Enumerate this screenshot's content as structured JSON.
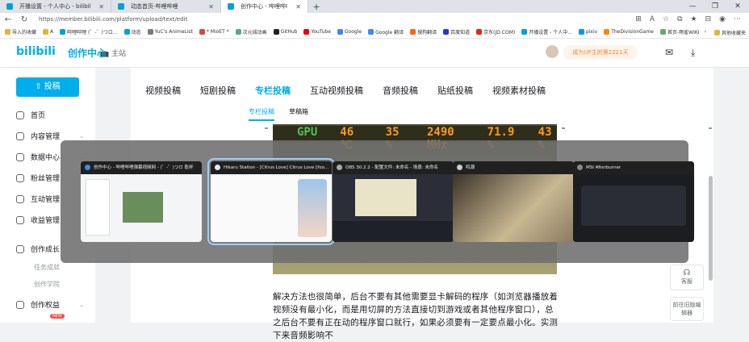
{
  "browser": {
    "tabs": [
      {
        "label": "开播设置 - 个人中心 - bilibili link",
        "active": false
      },
      {
        "label": "动态首页-哔哩哔哩",
        "active": false
      },
      {
        "label": "创作中心 - 哔哩哔哩弹幕视频网",
        "active": true
      }
    ],
    "new_tab": "+",
    "url": "https://member.bilibili.com/platform/upload/text/edit",
    "bookmarks": [
      "导入的收藏",
      "A",
      "哔哩哔哩 (゜-゜)つロ...",
      "动态",
      "YuC's AnimeList",
      "* MioET *",
      "次元城动画",
      "GitHub",
      "YouTube",
      "Google",
      "Google 翻译",
      "搜狗翻译",
      "百度知道",
      "京东(JD.COM)",
      "开播设置 - 个人中...",
      "pixiv",
      "TheDivisionGame",
      "首页-雨雀WIKI攻略..."
    ],
    "bookmarks_right": "其他收藏夹"
  },
  "site": {
    "logo": "bilibili",
    "logo_text": "创作中心",
    "home": "主站",
    "up_button": "成为UP主的第2221天"
  },
  "sidebar": {
    "post_button": "投稿",
    "items": [
      "首页",
      "内容管理",
      "数据中心",
      "粉丝管理",
      "互动管理",
      "收益管理",
      "创作成长",
      "创作权益"
    ],
    "sub_items": [
      "任务成就",
      "创作学院"
    ],
    "new_badge": "NEW"
  },
  "main": {
    "tabs": [
      "视频投稿",
      "短剧投稿",
      "专栏投稿",
      "互动视频投稿",
      "音频投稿",
      "贴纸投稿",
      "视频素材投稿"
    ],
    "active_tab": "专栏投稿",
    "subtabs": [
      "专栏投稿",
      "草稿箱"
    ],
    "hud": [
      "GPU",
      "46 ℃",
      "35 %",
      "2490 MHz",
      "71.9 %",
      "43 %"
    ],
    "paragraph": "解决方法也很简单，后台不要有其他需要显卡解码的程序（如浏览器播放着视频没有最小化，而是用切屏的方法直接切到游戏或者其他程序窗口），总之后台不要有正在动的程序窗口就行，如果必须要有一定要点最小化。实测下来音频影响不",
    "float_buttons": [
      "客服",
      "前往旧版编辑器"
    ]
  },
  "switcher": {
    "windows": [
      {
        "title": "创作中心 - 哔哩哔哩弹幕视频网 - (゜-゜)つロ 乾杯",
        "selected": false,
        "icon_color": "#3a8ee6"
      },
      {
        "title": "Hikaru Station - [Citrus Love] Citrus Love [foo...",
        "selected": true,
        "icon_color": "#e6e6e6"
      },
      {
        "title": "OBS 30.2.2 - 配置文件: 未命名 - 场景: 未命名",
        "selected": false,
        "icon_color": "#aaaaaa"
      },
      {
        "title": "鸣潮",
        "selected": false,
        "icon_color": "#cccccc"
      },
      {
        "title": "MSI Afterburner",
        "selected": false,
        "icon_color": "#888888"
      }
    ]
  }
}
